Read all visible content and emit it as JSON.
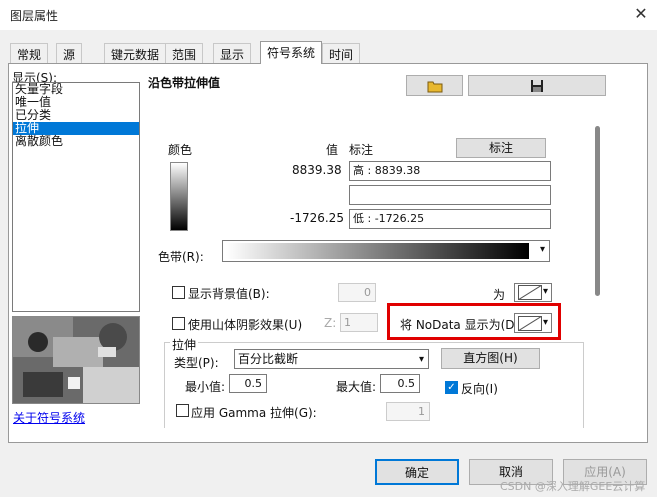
{
  "window": {
    "title": "图层属性",
    "close": "✕"
  },
  "tabs": [
    {
      "label": "常规"
    },
    {
      "label": "源"
    },
    {
      "label": "键元数据"
    },
    {
      "label": "范围"
    },
    {
      "label": "显示"
    },
    {
      "label": "符号系统"
    },
    {
      "label": "时间"
    }
  ],
  "left": {
    "show_label": "显示(S):",
    "items": [
      "矢量字段",
      "唯一值",
      "已分类",
      "拉伸",
      "离散颜色"
    ],
    "selected_index": 3,
    "about_link": "关于符号系统"
  },
  "main": {
    "heading": "沿色带拉伸值",
    "col_color": "颜色",
    "col_value": "值",
    "col_label": "标注",
    "label_button": "标注",
    "high_value": "8839.38",
    "high_label": "高 : 8839.38",
    "mid_label": "",
    "low_value": "-1726.25",
    "low_label": "低 : -1726.25",
    "ramp_label": "色带(R):",
    "bg_checkbox": "显示背景值(B):",
    "bg_value": "0",
    "as_label": "为",
    "hillshade_checkbox": "使用山体阴影效果(U)",
    "z_label": "Z:",
    "z_value": "1",
    "nodata_label": "将 NoData 显示为(D)",
    "stretch_title": "拉伸",
    "type_label": "类型(P):",
    "type_value": "百分比截断",
    "histogram_button": "直方图(H)",
    "min_label": "最小值:",
    "min_value": "0.5",
    "max_label": "最大值:",
    "max_value": "0.5",
    "invert_label": "反向(I)",
    "invert_checked": true,
    "gamma_label": "应用 Gamma 拉伸(G):",
    "gamma_value": "1"
  },
  "footer": {
    "ok": "确定",
    "cancel": "取消",
    "apply": "应用(A)"
  },
  "watermark": "CSDN @深入理解GEE云计算",
  "colors": {
    "highlight_box": "#e00000",
    "selection": "#0078d7",
    "link": "#0000ee"
  }
}
